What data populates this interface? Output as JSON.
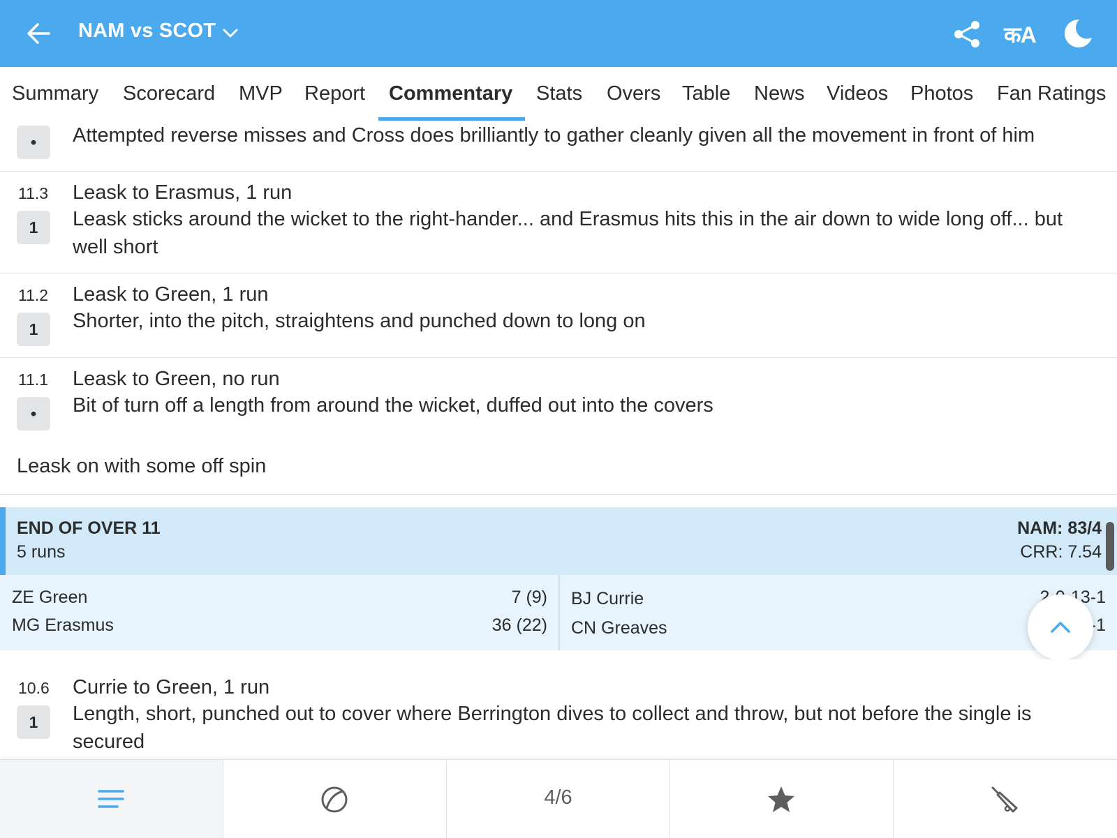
{
  "header": {
    "title": "NAM vs SCOT",
    "language_label": "कA",
    "icons": {
      "back": "arrow-left-icon",
      "dropdown": "chevron-down-icon",
      "share": "share-icon",
      "theme": "moon-icon"
    }
  },
  "tabs": [
    {
      "label": "Summary"
    },
    {
      "label": "Scorecard"
    },
    {
      "label": "MVP"
    },
    {
      "label": "Report"
    },
    {
      "label": "Commentary",
      "active": true
    },
    {
      "label": "Stats"
    },
    {
      "label": "Overs"
    },
    {
      "label": "Table"
    },
    {
      "label": "News"
    },
    {
      "label": "Videos"
    },
    {
      "label": "Photos"
    },
    {
      "label": "Fan Ratings"
    }
  ],
  "commentary": {
    "partial": {
      "badge": "•",
      "text": "Attempted reverse misses and Cross does brilliantly to gather cleanly given all the movement in front of him"
    },
    "balls": [
      {
        "over": "11.3",
        "badge": "1",
        "head": "Leask to Erasmus, 1 run",
        "text": "Leask sticks around the wicket to the right-hander... and Erasmus hits this in the air down to wide long off... but well short"
      },
      {
        "over": "11.2",
        "badge": "1",
        "head": "Leask to Green, 1 run",
        "text": "Shorter, into the pitch, straightens and punched down to long on"
      },
      {
        "over": "11.1",
        "badge": "•",
        "head": "Leask to Green, no run",
        "text": "Bit of turn off a length from around the wicket, duffed out into the covers"
      }
    ],
    "note": "Leask on with some off spin",
    "end_of_over": {
      "label": "END OF OVER 11",
      "runs": "5 runs",
      "score": "NAM: 83/4",
      "crr": "CRR: 7.54",
      "batters": [
        {
          "name": "ZE Green",
          "score": "7 (9)"
        },
        {
          "name": "MG Erasmus",
          "score": "36 (22)"
        }
      ],
      "bowlers": [
        {
          "name": "BJ Currie",
          "figures": "2-0-13-1"
        },
        {
          "name": "CN Greaves",
          "figures": "1-0-9-1"
        }
      ]
    },
    "next_ball": {
      "over": "10.6",
      "badge": "1",
      "head": "Currie to Green, 1 run",
      "text": "Length, short, punched out to cover where Berrington dives to collect and throw, but not before the single is secured"
    }
  },
  "scroll_top_icon": "chevron-up-icon",
  "bottom_nav": {
    "pager": "4/6",
    "icons": [
      "menu-lines-icon",
      "cricket-ball-icon",
      "star-icon",
      "cricket-bat-icon"
    ]
  },
  "colors": {
    "brand": "#4ba9ee",
    "over_summary_bg": "#d1e9f9",
    "players_bg": "#e8f4fd"
  }
}
